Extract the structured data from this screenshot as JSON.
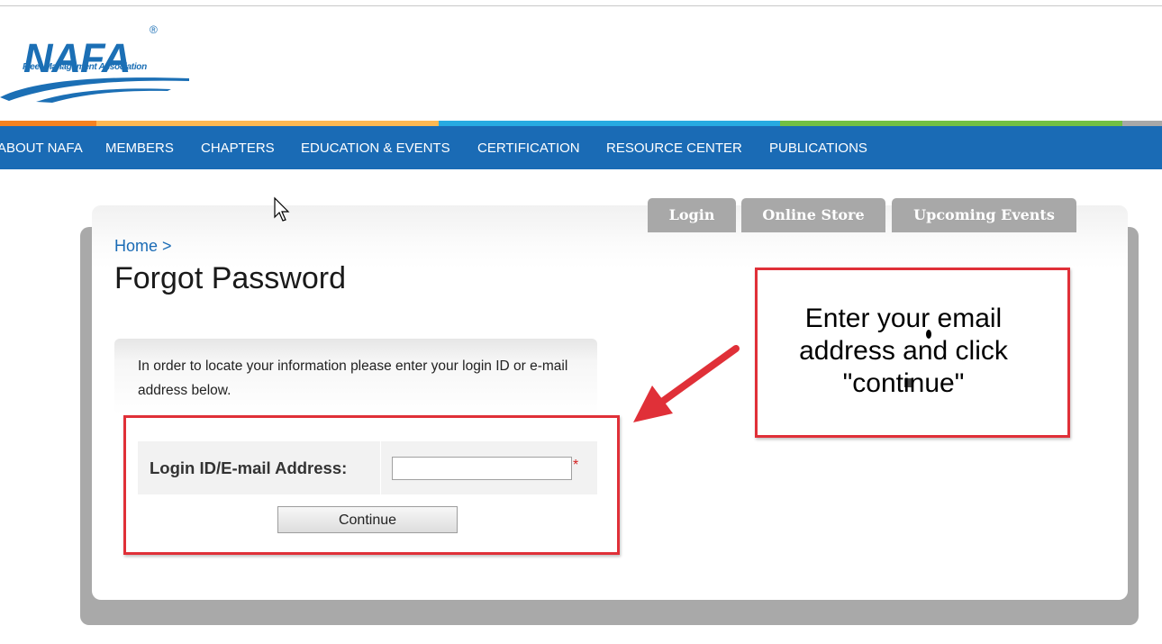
{
  "logo": {
    "text": "NAFA",
    "reg": "®",
    "subtitle": "Fleet Management Association"
  },
  "nav": {
    "items": [
      "ABOUT NAFA",
      "MEMBERS",
      "CHAPTERS",
      "EDUCATION & EVENTS",
      "CERTIFICATION",
      "RESOURCE CENTER",
      "PUBLICATIONS"
    ]
  },
  "tabs": [
    "Login",
    "Online Store",
    "Upcoming Events"
  ],
  "breadcrumb": "Home >",
  "page_title": "Forgot Password",
  "info_text": "In order to locate your information please enter your login ID or e-mail address below.",
  "form": {
    "label": "Login ID/E-mail Address:",
    "value": "",
    "required_mark": "*",
    "submit_label": "Continue"
  },
  "callout": {
    "text": "Enter your email address and click \"continue\""
  },
  "colors": {
    "brand_blue": "#1a6bb5",
    "bar_orange": "#f58220",
    "bar_light_orange": "#fdb853",
    "bar_cyan": "#27aae1",
    "bar_green": "#72bf44",
    "bar_gray": "#a8a8a8",
    "annotation_red": "#e03038"
  }
}
